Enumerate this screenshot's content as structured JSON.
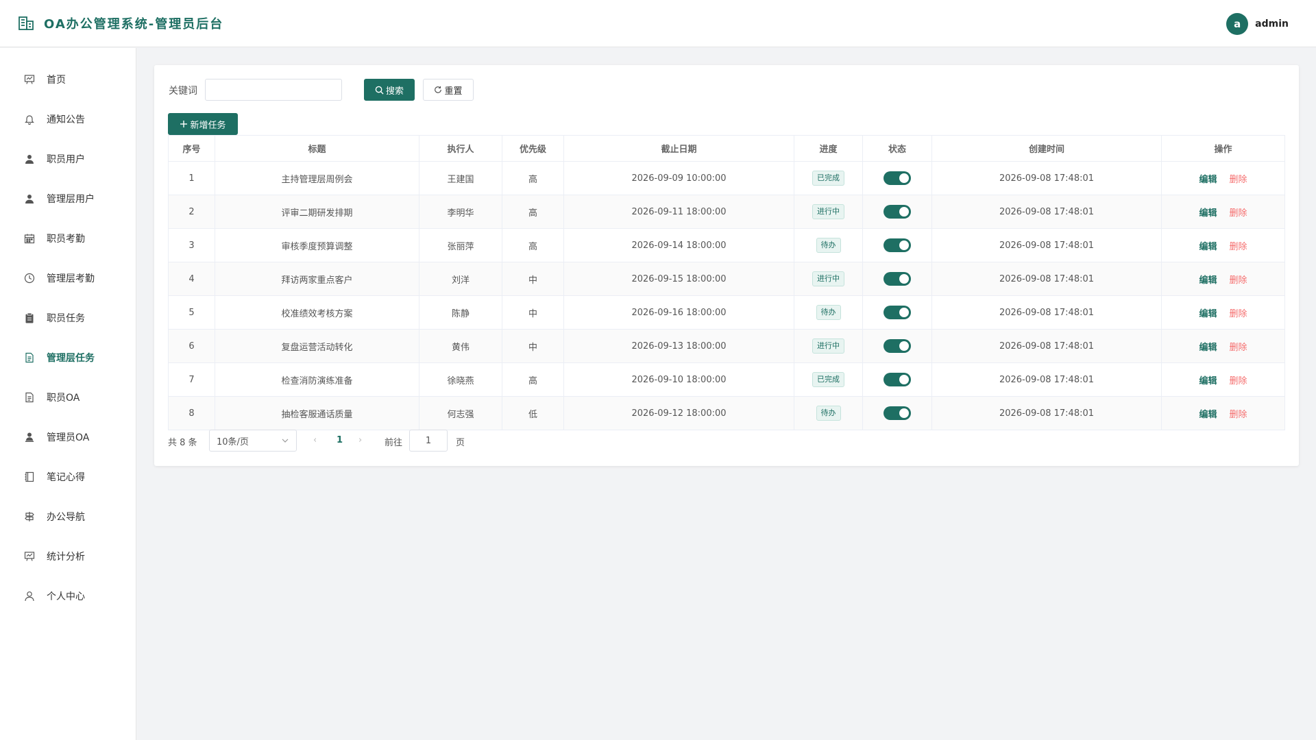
{
  "app": {
    "title": "OA办公管理系统-管理员后台",
    "brand_color": "#1e6f63"
  },
  "user": {
    "avatar_letter": "a",
    "name": "admin"
  },
  "sidebar": {
    "items": [
      {
        "label": "首页",
        "icon": "chart-board-icon"
      },
      {
        "label": "通知公告",
        "icon": "bell-icon"
      },
      {
        "label": "职员用户",
        "icon": "user-icon"
      },
      {
        "label": "管理层用户",
        "icon": "user-icon"
      },
      {
        "label": "职员考勤",
        "icon": "calendar-icon"
      },
      {
        "label": "管理层考勤",
        "icon": "clock-icon"
      },
      {
        "label": "职员任务",
        "icon": "clipboard-icon"
      },
      {
        "label": "管理层任务",
        "icon": "document-icon",
        "active": true
      },
      {
        "label": "职员OA",
        "icon": "document-icon"
      },
      {
        "label": "管理员OA",
        "icon": "admin-user-icon"
      },
      {
        "label": "笔记心得",
        "icon": "notebook-icon"
      },
      {
        "label": "办公导航",
        "icon": "signpost-icon"
      },
      {
        "label": "统计分析",
        "icon": "chart-board-icon"
      },
      {
        "label": "个人中心",
        "icon": "person-icon"
      }
    ]
  },
  "search": {
    "label": "关键词",
    "value": "",
    "placeholder": "",
    "search_button": "搜索",
    "reset_button": "重置",
    "add_button": "新增任务"
  },
  "table": {
    "headers": [
      "序号",
      "标题",
      "执行人",
      "优先级",
      "截止日期",
      "进度",
      "状态",
      "创建时间",
      "操作"
    ],
    "edit_label": "编辑",
    "delete_label": "删除",
    "rows": [
      {
        "no": "1",
        "title": "主持管理层周例会",
        "assignee": "王建国",
        "priority": "高",
        "deadline": "2026-09-09 10:00:00",
        "progress": "已完成",
        "enabled": true,
        "created": "2026-09-08 17:48:01"
      },
      {
        "no": "2",
        "title": "评审二期研发排期",
        "assignee": "李明华",
        "priority": "高",
        "deadline": "2026-09-11 18:00:00",
        "progress": "进行中",
        "enabled": true,
        "created": "2026-09-08 17:48:01"
      },
      {
        "no": "3",
        "title": "审核季度预算调整",
        "assignee": "张丽萍",
        "priority": "高",
        "deadline": "2026-09-14 18:00:00",
        "progress": "待办",
        "enabled": true,
        "created": "2026-09-08 17:48:01"
      },
      {
        "no": "4",
        "title": "拜访两家重点客户",
        "assignee": "刘洋",
        "priority": "中",
        "deadline": "2026-09-15 18:00:00",
        "progress": "进行中",
        "enabled": true,
        "created": "2026-09-08 17:48:01"
      },
      {
        "no": "5",
        "title": "校准绩效考核方案",
        "assignee": "陈静",
        "priority": "中",
        "deadline": "2026-09-16 18:00:00",
        "progress": "待办",
        "enabled": true,
        "created": "2026-09-08 17:48:01"
      },
      {
        "no": "6",
        "title": "复盘运营活动转化",
        "assignee": "黄伟",
        "priority": "中",
        "deadline": "2026-09-13 18:00:00",
        "progress": "进行中",
        "enabled": true,
        "created": "2026-09-08 17:48:01"
      },
      {
        "no": "7",
        "title": "检查消防演练准备",
        "assignee": "徐晓燕",
        "priority": "高",
        "deadline": "2026-09-10 18:00:00",
        "progress": "已完成",
        "enabled": true,
        "created": "2026-09-08 17:48:01"
      },
      {
        "no": "8",
        "title": "抽检客服通话质量",
        "assignee": "何志强",
        "priority": "低",
        "deadline": "2026-09-12 18:00:00",
        "progress": "待办",
        "enabled": true,
        "created": "2026-09-08 17:48:01"
      }
    ]
  },
  "pagination": {
    "total_text": "共 8 条",
    "page_size": "10条/页",
    "prev": "‹",
    "current_page": "1",
    "next": "›",
    "goto_label": "前往",
    "goto_value": "1",
    "page_suffix": "页"
  }
}
